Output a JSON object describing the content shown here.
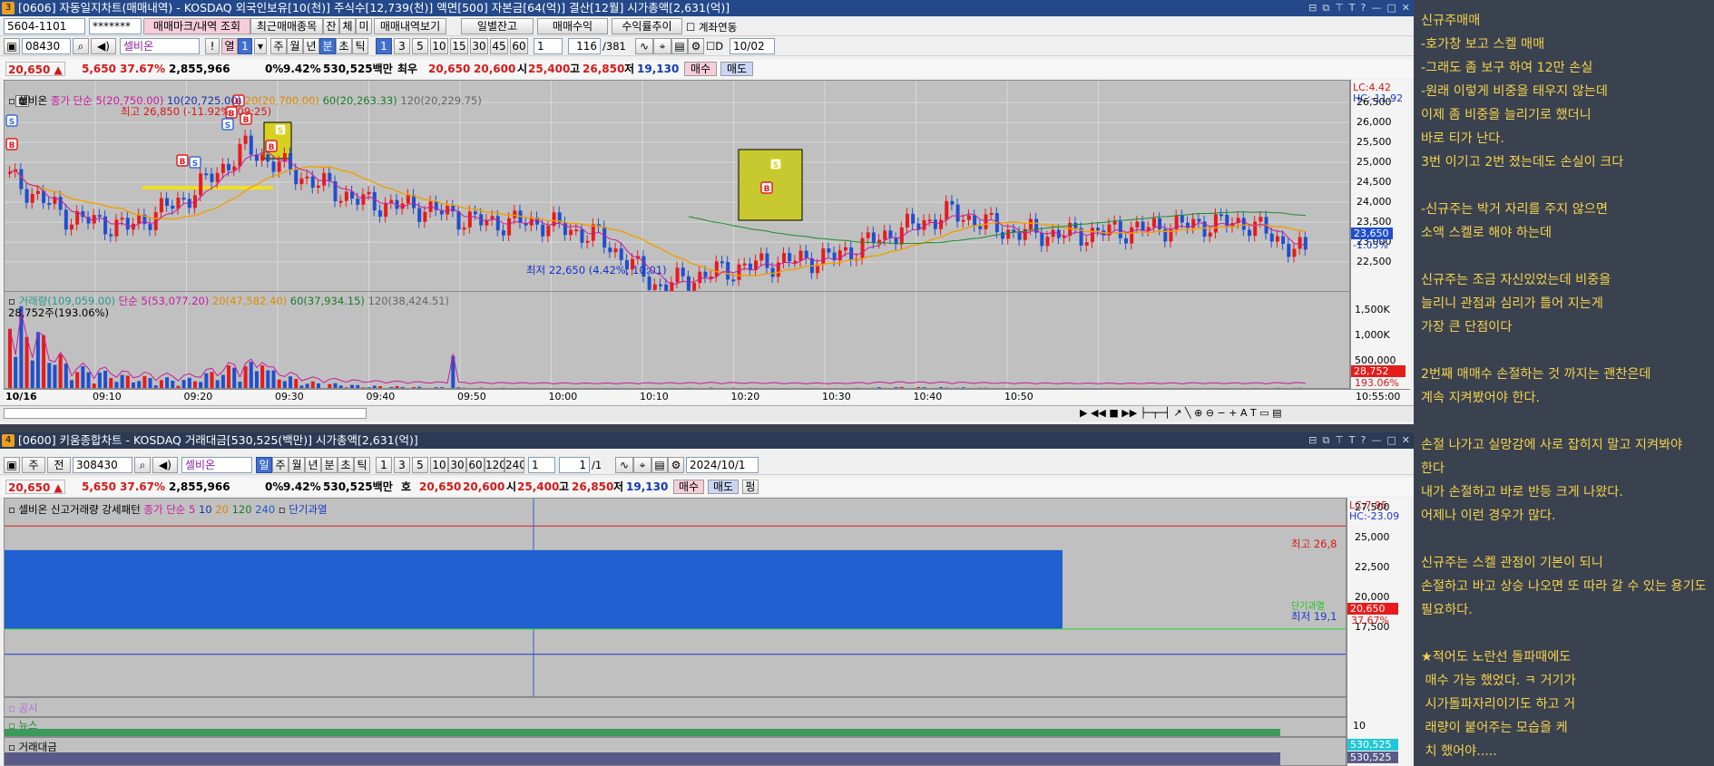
{
  "w1": {
    "title": "[0606] 자동일지차트(매매내역) - KOSDAQ 외국인보유[10(천)] 주식수[12,739(천)] 액면[500] 자본금[64(억)] 결산[12월] 시가총액[2,631(억)]",
    "account": "5604-1101",
    "password": "*******",
    "btn_mark": "매매마크/내역 조회",
    "btn_recent": "최근매매종목",
    "btn_jan": "잔",
    "btn_che": "체",
    "btn_mi": "미",
    "btn_hist": "매매내역보기",
    "btn_daily": "일별잔고",
    "btn_profit": "매매수익",
    "btn_rate": "수익률추이",
    "chk_link": "계좌연동",
    "code": "08430",
    "stock_name": "셀비온",
    "btn_excl": "!",
    "btn_yeol": "열",
    "period_num": "1",
    "periods": [
      "주",
      "월",
      "년",
      "분",
      "초",
      "틱"
    ],
    "intervals": [
      "1",
      "3",
      "5",
      "10",
      "15",
      "30",
      "45",
      "60"
    ],
    "count_sel": "1",
    "page_cur": "116",
    "page_total": "/381",
    "date": "10/02",
    "info": {
      "price": "20,650 ▲",
      "change": "5,650",
      "pct": "37.67%",
      "vol": "2,855,966",
      "z": "0%",
      "rate": "9.42%",
      "amount": "530,525백만",
      "hoga": "최우",
      "bid": "20,650",
      "ask": "20,600",
      "open_l": "시",
      "open": "25,400",
      "high_l": "고",
      "high": "26,850",
      "low_l": "저",
      "low": "19,130",
      "buy": "매수",
      "sell": "매도"
    },
    "legend": {
      "name": "셀비온",
      "ma_type": "종가 단순",
      "ma5": "5(20,750.00)",
      "ma10": "10(20,725.00)",
      "ma20": "20(20,700.00)",
      "ma60": "60(20,263.33)",
      "ma120": "120(20,229.75)"
    },
    "high_annot": "최고 26,850 (-11.92%, 09:25)",
    "low_annot": "최저 22,650 (4.42%, 10:01)",
    "lc": "LC:4.42",
    "hc": "HC:-11.92",
    "price_ticks": [
      "26,500",
      "26,000",
      "25,500",
      "25,000",
      "24,500",
      "24,000",
      "23,500",
      "23,000",
      "22,500"
    ],
    "cur_price": "23,650",
    "cur_pct": "-1.05%",
    "vol_legend": {
      "name": "거래량(109,059.00)",
      "ma_type": "단순",
      "ma5": "5(53,077.20)",
      "ma20": "20(47,582.40)",
      "ma60": "60(37,934.15)",
      "ma120": "120(38,424.51)"
    },
    "vol_sub": "28,752주(193.06%)",
    "vol_ticks": [
      "1,500K",
      "1,000K",
      "500,000"
    ],
    "vol_cur": "28,752",
    "vol_pct": "193.06%",
    "date_label": "10/16",
    "times": [
      "09:10",
      "09:20",
      "09:30",
      "09:40",
      "09:50",
      "10:00",
      "10:10",
      "10:20",
      "10:30",
      "10:40",
      "10:50"
    ],
    "end_time": "10:55:00"
  },
  "w2": {
    "title": "[0600] 키움종합차트 - KOSDAQ 거래대금[530,525(백만)] 시가총액[2,631(억)]",
    "ju": "주",
    "jeon": "전",
    "code": "308430",
    "stock_name": "셀비온",
    "btn_il": "일",
    "periods": [
      "주",
      "월",
      "년",
      "분",
      "초",
      "틱"
    ],
    "intervals": [
      "1",
      "3",
      "5",
      "10",
      "30",
      "60",
      "120",
      "240"
    ],
    "count_sel": "1",
    "page": "1",
    "page_total": "/1",
    "date": "2024/10/1",
    "info": {
      "price": "20,650 ▲",
      "change": "5,650",
      "pct": "37.67%",
      "vol": "2,855,966",
      "z": "0%",
      "rate": "9.42%",
      "amount": "530,525백만",
      "hoga": "호",
      "bid": "20,650",
      "ask": "20,600",
      "open_l": "시",
      "open": "25,400",
      "high_l": "고",
      "high": "26,850",
      "low_l": "저",
      "low": "19,130",
      "buy": "매수",
      "sell": "매도",
      "extra": "펑"
    },
    "legend": {
      "name": "셀비온",
      "pattern": "신고거래량 강세패턴",
      "ma_type": "종가 단순",
      "ma5": "5",
      "ma10": "10",
      "ma20": "20",
      "ma120": "120",
      "ma240": "240",
      "extra": "단기과열"
    },
    "lc": "LC:7.95",
    "hc": "HC:-23.09",
    "price_ticks": [
      "27,500",
      "25,000",
      "22,500",
      "20,000",
      "17,500"
    ],
    "high_annot": "최고 26,8",
    "low_annot": "최저 19,1",
    "ma_annot": "단기과열",
    "cur_price": "20,650",
    "cur_pct": "37.67%",
    "panel_gongsi": "공시",
    "panel_news": "뉴스",
    "panel_amount": "거래대금",
    "news_tick": "10",
    "amt_val": "530,525",
    "amt_val2": "530,525"
  },
  "note": [
    "신규주매매",
    "-호가창 보고 스켈 매매",
    "-그래도 좀 보구 하여 12만 손실",
    "-원래 이렇게 비중을 태우지 않는데",
    "이제 좀 비중을 늘리기로 했더니",
    "바로 티가 난다.",
    "3번 이기고 2번 졌는데도 손실이 크다",
    "",
    "-신규주는 박거 자리를 주지 않으면",
    "소액 스켈로 해야 하는데",
    "",
    "신규주는 조금 자신있었는데 비중을",
    "늘리니 관점과 심리가 틀어 지는게",
    "가장 큰 단점이다",
    "",
    "2번째 매매수 손절하는 것 까지는 괜찬은데",
    "계속 지켜봤어야 한다.",
    "",
    "손절 나가고 실망감에 사로 잡히지 말고 지켜봐야 한다",
    "내가 손절하고 바로 반등 크게 나왔다.",
    "어제나 이런 경우가 많다.",
    "",
    "신규주는 스켈 관점이 기본이 되니",
    "손절하고 바고 상승 나오면 또 따라 갈 수 있는 용기도 필요하다.",
    "",
    "★적어도 노란선 돌파때에도",
    " 매수 가능 했었다. ㅋ 거기가",
    " 시가돌파자리이기도 하고 거",
    " 래량이 붙어주는 모습을 케",
    " 치 했어야....."
  ],
  "chart_data": [
    {
      "type": "candlestick",
      "panel": "minute price",
      "x": [
        "09:05",
        "09:10",
        "09:15",
        "09:20",
        "09:25",
        "09:30",
        "09:35",
        "09:40",
        "09:45",
        "09:50",
        "09:55",
        "10:00",
        "10:05",
        "10:10",
        "10:15",
        "10:20",
        "10:25",
        "10:30",
        "10:35",
        "10:40",
        "10:45",
        "10:50",
        "10:55"
      ],
      "close": [
        25200,
        24400,
        24200,
        24800,
        25800,
        25200,
        24700,
        24600,
        24300,
        24300,
        24000,
        23000,
        23300,
        23500,
        23600,
        24100,
        24500,
        24100,
        24050,
        24150,
        24250,
        24300,
        23650
      ],
      "ylim": [
        22400,
        26800
      ],
      "high": 26850,
      "low": 22650,
      "colors": {
        "up": "#e81b1b",
        "down": "#1f4fcf",
        "bg": "#c0c0c0"
      }
    },
    {
      "type": "bar",
      "panel": "volume",
      "x": [
        "09:05",
        "09:10",
        "09:15",
        "09:20",
        "09:25",
        "09:30",
        "09:35",
        "09:40",
        "09:45",
        "09:50",
        "09:55",
        "10:00",
        "10:05",
        "10:10",
        "10:15",
        "10:20",
        "10:25",
        "10:30",
        "10:35",
        "10:40",
        "10:45",
        "10:50",
        "10:55"
      ],
      "values": [
        1300000,
        350000,
        200000,
        150000,
        400000,
        120000,
        60000,
        40000,
        30000,
        25000,
        20000,
        25000,
        30000,
        25000,
        20000,
        40000,
        35000,
        25000,
        20000,
        20000,
        25000,
        25000,
        28752
      ],
      "ylim": [
        0,
        1700000
      ]
    },
    {
      "type": "bar",
      "panel": "daily price",
      "categories": [
        "2024/10/16"
      ],
      "open": 25400,
      "high": 26850,
      "low": 19130,
      "close": 20650,
      "ylim": [
        16500,
        28500
      ]
    }
  ]
}
